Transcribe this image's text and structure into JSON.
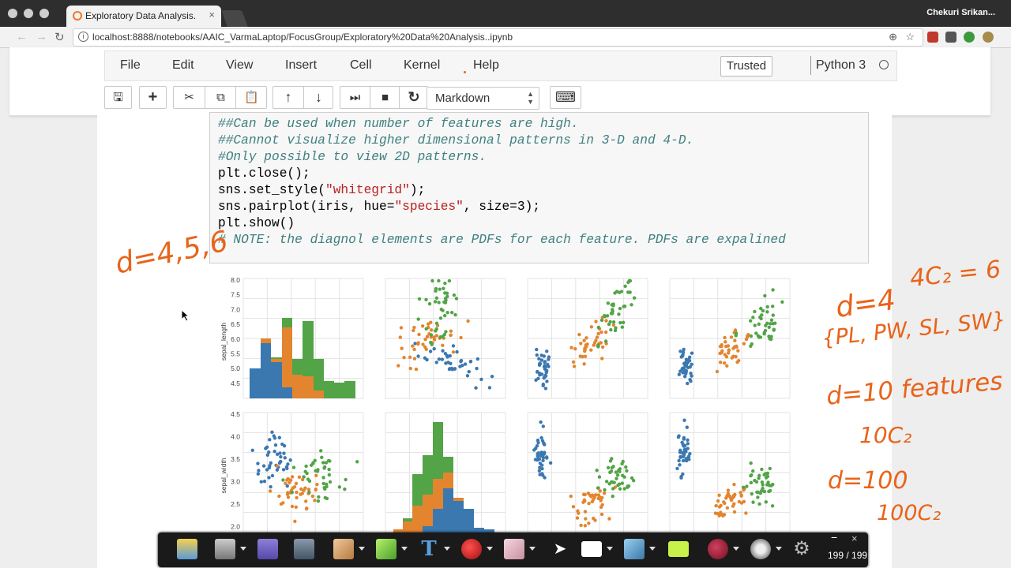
{
  "browser": {
    "tab_title": "Exploratory Data Analysis.",
    "tab_close": "×",
    "user": "Chekuri Srikan...",
    "url": "localhost:8888/notebooks/AAIC_VarmaLaptop/FocusGroup/Exploratory%20Data%20Analysis..ipynb",
    "nav": {
      "back": "←",
      "forward": "→",
      "reload": "↻"
    },
    "icons": {
      "info": "i",
      "zoom": "⊕",
      "star": "☆"
    }
  },
  "jupyter": {
    "menu": [
      "File",
      "Edit",
      "View",
      "Insert",
      "Cell",
      "Kernel",
      "Help"
    ],
    "trusted": "Trusted",
    "kernel": "Python 3",
    "cell_type": "Markdown",
    "toolbar_icons": {
      "save": "🖫",
      "add": "+",
      "cut": "✂",
      "copy": "⧉",
      "paste": "📋",
      "up": "↑",
      "down": "↓",
      "run": "⏭",
      "stop": "■",
      "restart": "↻",
      "keyboard": "⌨"
    }
  },
  "code": {
    "lines": [
      {
        "text": "##Can be used when number of features are high.",
        "kind": "comment"
      },
      {
        "text": "##Cannot visualize higher dimensional patterns in 3-D and 4-D.",
        "kind": "comment"
      },
      {
        "text": "#Only possible to view 2D patterns.",
        "kind": "comment"
      },
      {
        "text": "plt.close();",
        "kind": "code"
      },
      {
        "pre": "sns.set_style(",
        "str": "\"whitegrid\"",
        "post": ");",
        "kind": "mixed"
      },
      {
        "pre": "sns.pairplot(iris, hue=",
        "str": "\"species\"",
        "post": ", size=3);",
        "kind": "mixed"
      },
      {
        "text": "plt.show()",
        "kind": "code"
      },
      {
        "text": "# NOTE: the diagnol elements are PDFs for each feature. PDFs are expalined",
        "kind": "comment"
      }
    ]
  },
  "plot": {
    "colors": {
      "setosa": "#3b78b0",
      "versicolor": "#e3852f",
      "virginica": "#52a447"
    },
    "row_labels": [
      "sepal_length",
      "sepal_width"
    ],
    "row1_ticks": [
      "8.0",
      "7.5",
      "7.0",
      "6.5",
      "6.0",
      "5.5",
      "5.0",
      "4.5"
    ],
    "row2_ticks": [
      "4.5",
      "4.0",
      "3.5",
      "3.0",
      "2.5",
      "2.0"
    ]
  },
  "annotations": {
    "left": "d=4,5,6",
    "comb": "4C₂ = 6",
    "d4": "d=4",
    "features": "{PL, PW, SL, SW}",
    "d10": "d=10 features",
    "c10": "10C₂",
    "d100": "d=100",
    "c100": "100C₂"
  },
  "pen_toolbar": {
    "page": "199 / 199",
    "minimize": "−",
    "close": "×"
  }
}
